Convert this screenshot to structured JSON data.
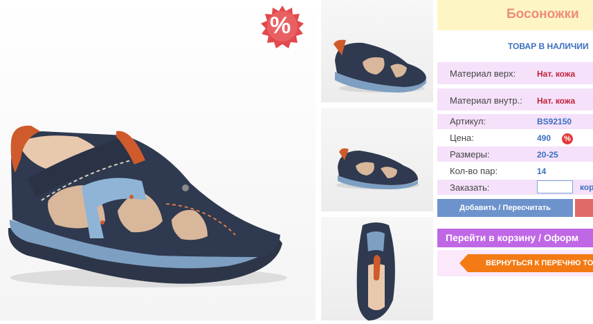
{
  "product": {
    "title": "Босоножки",
    "stock_status": "ТОВАР В НАЛИЧИИ",
    "sale_badge": "%",
    "price_discount_badge": "%"
  },
  "details": [
    {
      "label": "Материал верх:",
      "value": "Нат. кожа"
    },
    {
      "label": "Материал внутр.:",
      "value": "Нат. кожа"
    },
    {
      "label": "Артикул:",
      "value": "BS92150"
    },
    {
      "label": "Цена:",
      "value": "490"
    },
    {
      "label": "Размеры:",
      "value": "20-25"
    },
    {
      "label": "Кол-во пар:",
      "value": "14"
    },
    {
      "label": "Заказать:",
      "value": ""
    }
  ],
  "order": {
    "quantity_value": "",
    "cart_link": "кор"
  },
  "buttons": {
    "add_recalc": "Добавить / Пересчитать",
    "go_to_cart": "Перейти в корзину / Оформ",
    "back_to_list": "ВЕРНУТЬСЯ К ПЕРЕЧНЮ ТОВ"
  },
  "colors": {
    "title_bg": "#fdf6c4",
    "title_text": "#f08a7a",
    "row_bg": "#f5e1fa",
    "value_red": "#c4223a",
    "value_blue": "#3a6fc0",
    "add_button": "#6d93cc",
    "cart_button": "#c067e6",
    "back_button": "#f47a14",
    "sale_badge": "#e2494d"
  }
}
